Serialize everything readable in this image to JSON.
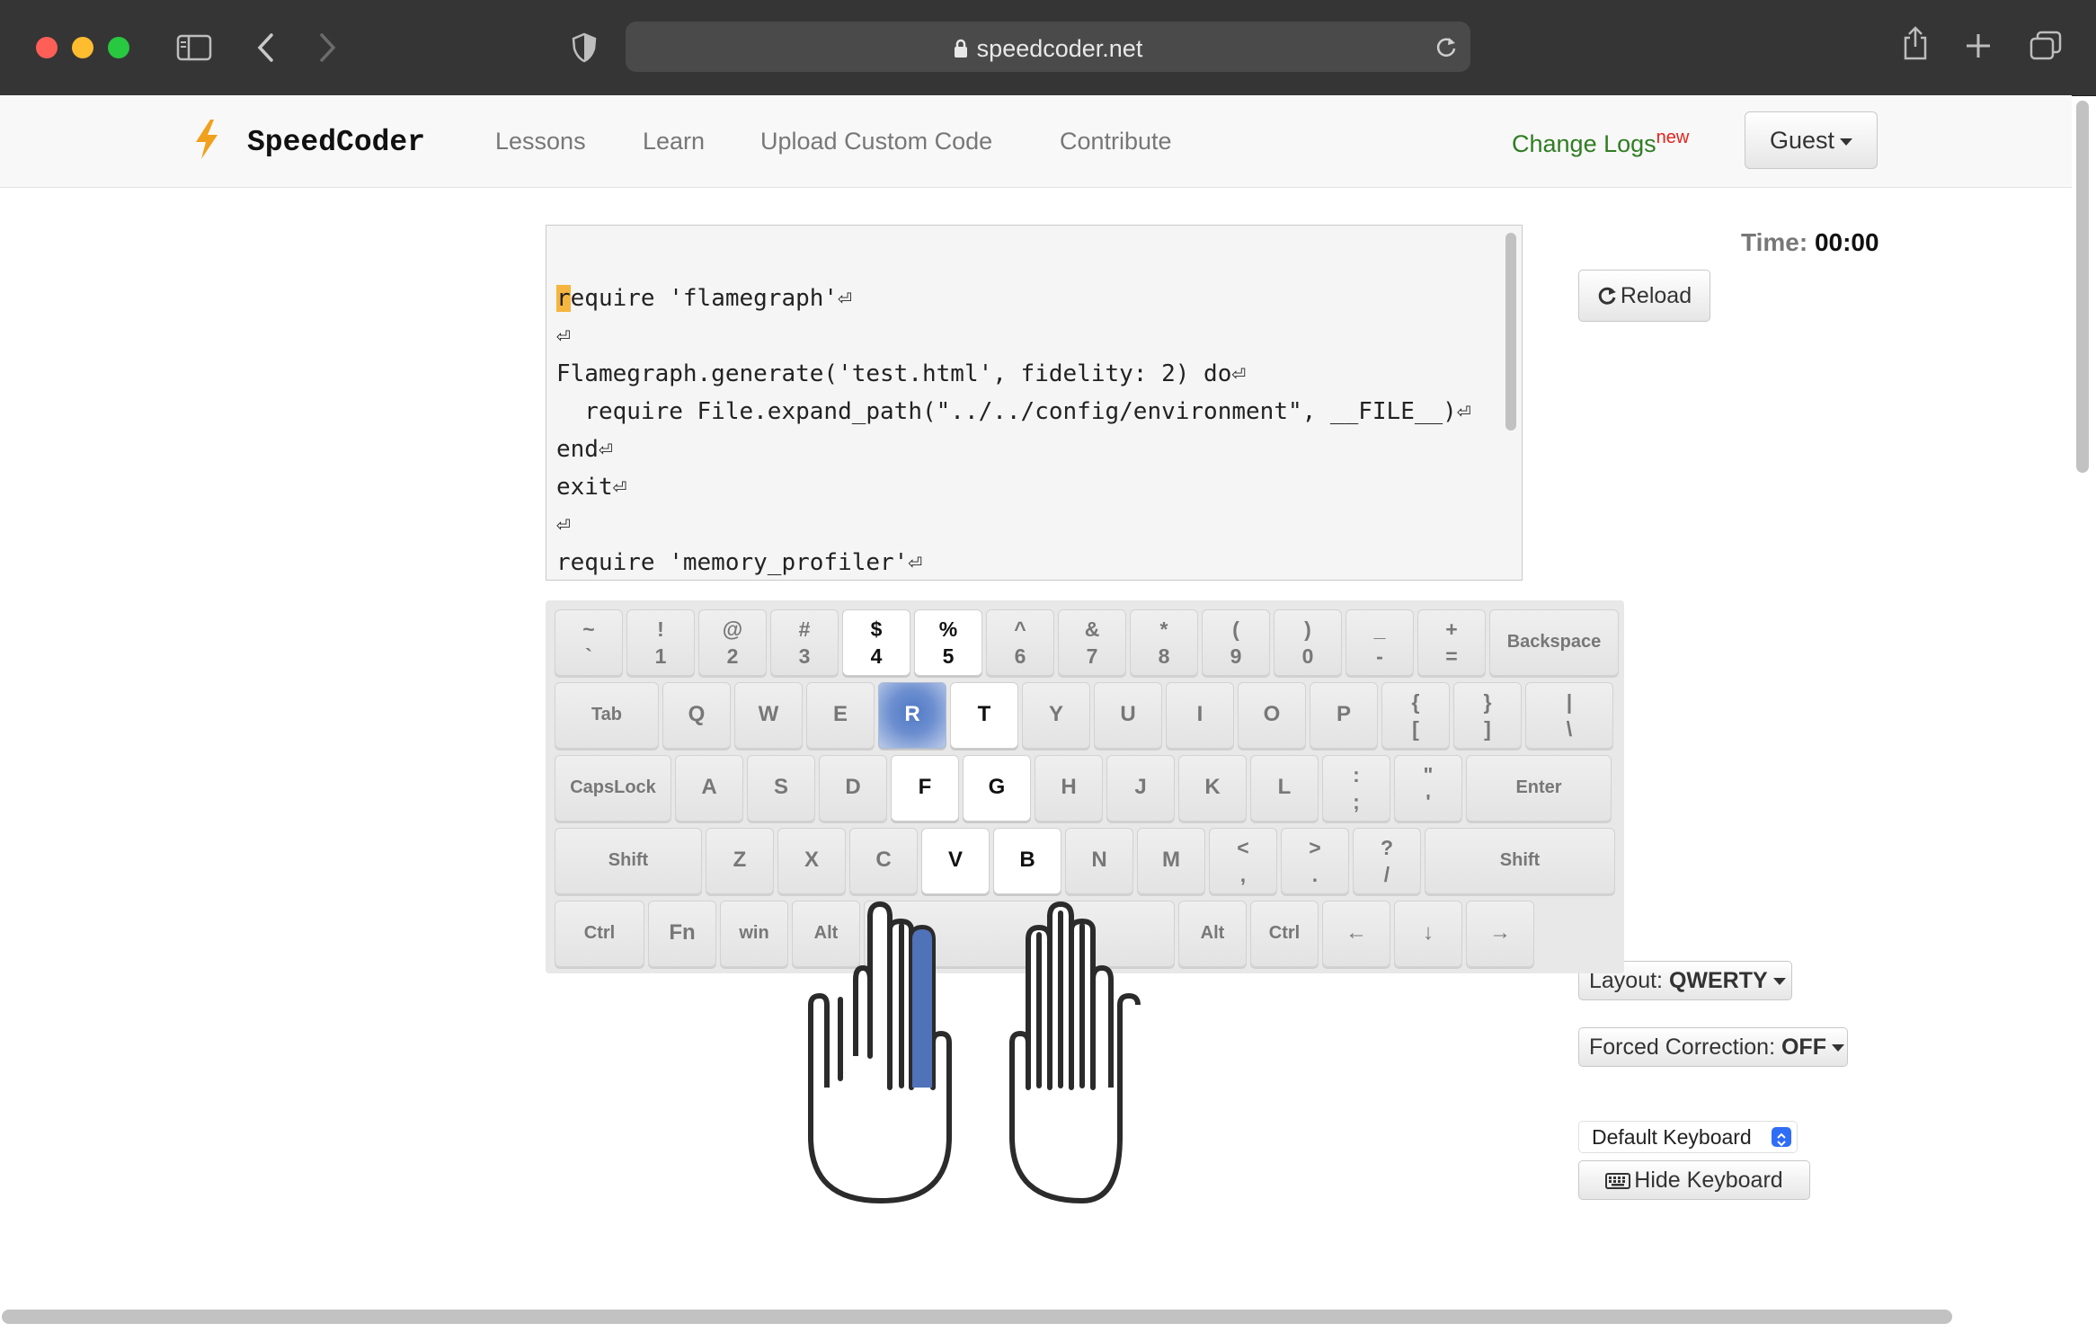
{
  "browser": {
    "url": "speedcoder.net"
  },
  "nav": {
    "brand": "SpeedCoder",
    "links": [
      "Lessons",
      "Learn",
      "Upload Custom Code",
      "Contribute"
    ],
    "changelog": "Change Logs",
    "changelog_badge": "new",
    "user_menu": "Guest"
  },
  "code": {
    "cursor_char": "r",
    "lines": [
      "equire 'flamegraph'⏎",
      "⏎",
      "Flamegraph.generate('test.html', fidelity: 2) do⏎",
      "  require File.expand_path(\"../../config/environment\", __FILE__)⏎",
      "end⏎",
      "exit⏎",
      "⏎",
      "require 'memory_profiler'⏎"
    ]
  },
  "timer": {
    "label": "Time:",
    "value": "00:00"
  },
  "controls": {
    "reload": "Reload",
    "layout_label": "Layout:",
    "layout_value": "QWERTY",
    "forced_label": "Forced Correction:",
    "forced_value": "OFF",
    "keyboard_select": "Default Keyboard",
    "hide_keyboard": "Hide Keyboard"
  },
  "keyboard": {
    "active_key": "R",
    "highlighted_keys": [
      "4",
      "5",
      "R",
      "T",
      "F",
      "G",
      "V",
      "B"
    ],
    "active_finger": "left-index",
    "rows": [
      [
        [
          "~",
          "`"
        ],
        [
          "!",
          "1"
        ],
        [
          "@",
          "2"
        ],
        [
          "#",
          "3"
        ],
        [
          "$",
          "4"
        ],
        [
          "%",
          "5"
        ],
        [
          "^",
          "6"
        ],
        [
          "&",
          "7"
        ],
        [
          "*",
          "8"
        ],
        [
          "(",
          "9"
        ],
        [
          ")",
          "0"
        ],
        [
          "_",
          "-"
        ],
        [
          "+",
          "="
        ],
        [
          "Backspace"
        ]
      ],
      [
        [
          "Tab"
        ],
        [
          "Q"
        ],
        [
          "W"
        ],
        [
          "E"
        ],
        [
          "R"
        ],
        [
          "T"
        ],
        [
          "Y"
        ],
        [
          "U"
        ],
        [
          "I"
        ],
        [
          "O"
        ],
        [
          "P"
        ],
        [
          "{",
          "["
        ],
        [
          "}",
          "]"
        ],
        [
          "|",
          "\\"
        ]
      ],
      [
        [
          "CapsLock"
        ],
        [
          "A"
        ],
        [
          "S"
        ],
        [
          "D"
        ],
        [
          "F"
        ],
        [
          "G"
        ],
        [
          "H"
        ],
        [
          "J"
        ],
        [
          "K"
        ],
        [
          "L"
        ],
        [
          ":",
          ";"
        ],
        [
          "\"",
          "'"
        ],
        [
          "Enter"
        ]
      ],
      [
        [
          "Shift"
        ],
        [
          "Z"
        ],
        [
          "X"
        ],
        [
          "C"
        ],
        [
          "V"
        ],
        [
          "B"
        ],
        [
          "N"
        ],
        [
          "M"
        ],
        [
          "<",
          ","
        ],
        [
          ">",
          "."
        ],
        [
          "?",
          "/"
        ],
        [
          "Shift"
        ]
      ],
      [
        [
          "Ctrl"
        ],
        [
          "Fn"
        ],
        [
          "win"
        ],
        [
          "Alt"
        ],
        [
          " "
        ],
        [
          "Alt"
        ],
        [
          "Ctrl"
        ],
        [
          "←"
        ],
        [
          "↓"
        ],
        [
          "→"
        ]
      ]
    ]
  }
}
